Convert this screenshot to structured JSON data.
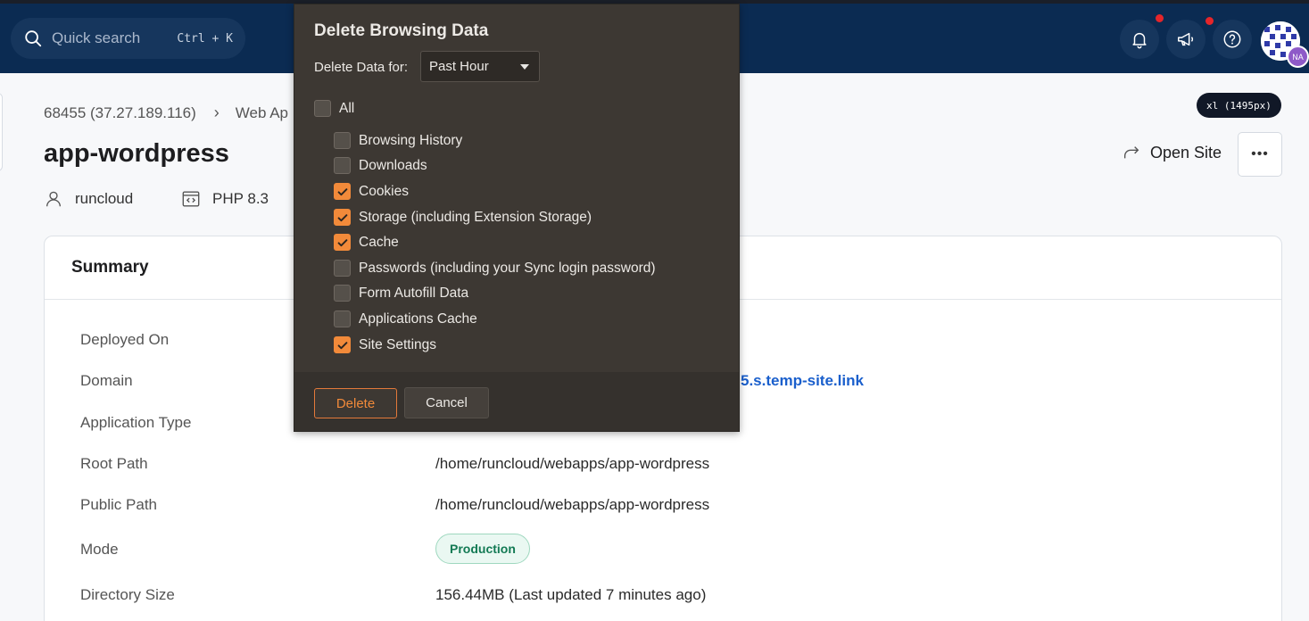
{
  "topbar": {
    "search_placeholder": "Quick search",
    "search_shortcut": "Ctrl + K",
    "avatar_initials": "NA"
  },
  "breakpoint_badge": "xl (1495px)",
  "breadcrumb": {
    "server": "68455 (37.27.189.116)",
    "section": "Web Ap"
  },
  "page_title": "app-wordpress",
  "meta": {
    "user": "runcloud",
    "php": "PHP 8.3"
  },
  "actions": {
    "open_site": "Open Site",
    "more": "•••"
  },
  "summary": {
    "title": "Summary",
    "rows": [
      {
        "label": "Deployed On",
        "value": ""
      },
      {
        "label": "Domain",
        "value": "5.s.temp-site.link"
      },
      {
        "label": "Application Type",
        "value": ""
      },
      {
        "label": "Root Path",
        "value": "/home/runcloud/webapps/app-wordpress"
      },
      {
        "label": "Public Path",
        "value": "/home/runcloud/webapps/app-wordpress"
      },
      {
        "label": "Mode",
        "value": "Production"
      },
      {
        "label": "Directory Size",
        "value": "156.44MB (Last updated 7 minutes ago)"
      }
    ]
  },
  "dialog": {
    "title": "Delete Browsing Data",
    "for_label": "Delete Data for:",
    "range": "Past Hour",
    "all_label": "All",
    "items": [
      {
        "label": "Browsing History",
        "checked": false
      },
      {
        "label": "Downloads",
        "checked": false
      },
      {
        "label": "Cookies",
        "checked": true
      },
      {
        "label": "Storage (including Extension Storage)",
        "checked": true
      },
      {
        "label": "Cache",
        "checked": true
      },
      {
        "label": "Passwords (including your Sync login password)",
        "checked": false
      },
      {
        "label": "Form Autofill Data",
        "checked": false
      },
      {
        "label": "Applications Cache",
        "checked": false
      },
      {
        "label": "Site Settings",
        "checked": true
      }
    ],
    "delete_label": "Delete",
    "cancel_label": "Cancel"
  },
  "colors": {
    "topbar": "#0b2b52",
    "dialog_bg": "#3d3833",
    "accent": "#f28a3a",
    "link": "#1a5fcc",
    "production": "#137a54"
  }
}
